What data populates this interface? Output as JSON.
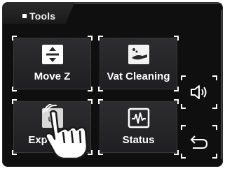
{
  "screen": {
    "title": "Tools"
  },
  "tiles": [
    {
      "label": "Move Z",
      "icon": "move-z-icon"
    },
    {
      "label": "Vat Cleaning",
      "icon": "vat-cleaning-icon"
    },
    {
      "label": "Exposure",
      "icon": "uv-exposure-icon"
    },
    {
      "label": "Status",
      "icon": "status-waveform-icon"
    }
  ],
  "side_buttons": [
    {
      "icon": "speaker-icon"
    },
    {
      "icon": "back-arrow-icon"
    }
  ],
  "overlay": {
    "icon": "tap-hand-icon"
  }
}
